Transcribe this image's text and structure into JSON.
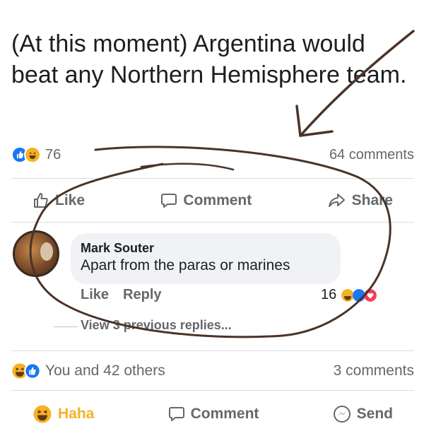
{
  "post": {
    "text": "(At this moment) Argentina would beat any Northern Hemisphere team.",
    "reaction_count": "76",
    "comments_count": "64 comments"
  },
  "post_actions": {
    "like": "Like",
    "comment": "Comment",
    "share": "Share"
  },
  "comment": {
    "author": "Mark Souter",
    "text": "Apart from the paras or marines",
    "like": "Like",
    "reply": "Reply",
    "reaction_count": "16",
    "view_replies": "View 3 previous replies..."
  },
  "footer": {
    "reactions_text": "You and 42 others",
    "comments_count": "3 comments",
    "haha": "Haha",
    "comment": "Comment",
    "send": "Send"
  },
  "colors": {
    "like_blue": "#1877f2",
    "haha_yellow": "#f7b125",
    "love_red": "#f33e58",
    "ink": "#4a3328"
  },
  "icons": [
    "like-icon",
    "haha-icon",
    "love-icon",
    "thumbs-up-icon",
    "comment-icon",
    "share-icon",
    "messenger-icon"
  ]
}
